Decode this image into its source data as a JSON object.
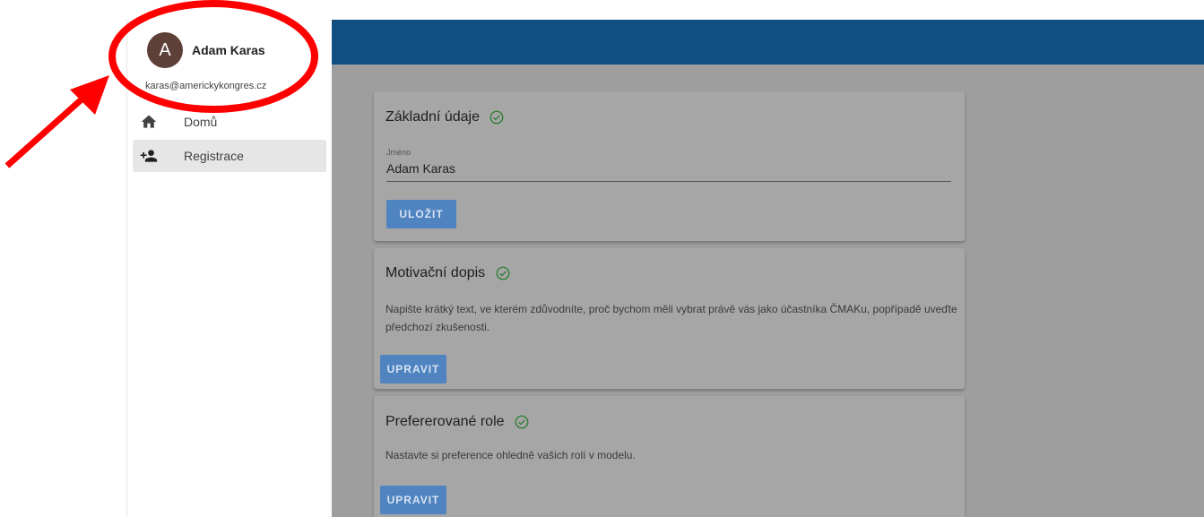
{
  "user": {
    "avatar_initial": "A",
    "name": "Adam Karas",
    "email": "karas@americkykongres.cz"
  },
  "nav": {
    "items": [
      {
        "label": "Domů",
        "icon": "home-icon"
      },
      {
        "label": "Registrace",
        "icon": "person-add-icon"
      }
    ],
    "active": "Registrace"
  },
  "cards": {
    "basic": {
      "title": "Základní údaje",
      "field_label": "Jméno",
      "field_value": "Adam Karas",
      "button": "ULOŽIT"
    },
    "motivation": {
      "title": "Motivační dopis",
      "description": "Napište krátký text, ve kterém zdůvodníte, proč bychom měli vybrat právě vás jako účastníka ČMAKu, popřípadě uveďte předchozí zkušenosti.",
      "button": "UPRAVIT"
    },
    "roles": {
      "title": "Prefererované role",
      "description": "Nastavte si preference ohledně vašich rolí v modelu.",
      "button": "UPRAVIT"
    }
  },
  "colors": {
    "header": "#114e82",
    "avatar": "#5d4037",
    "check": "#2e7d32",
    "button": "#4f84c0",
    "annotation": "#ff0000"
  }
}
